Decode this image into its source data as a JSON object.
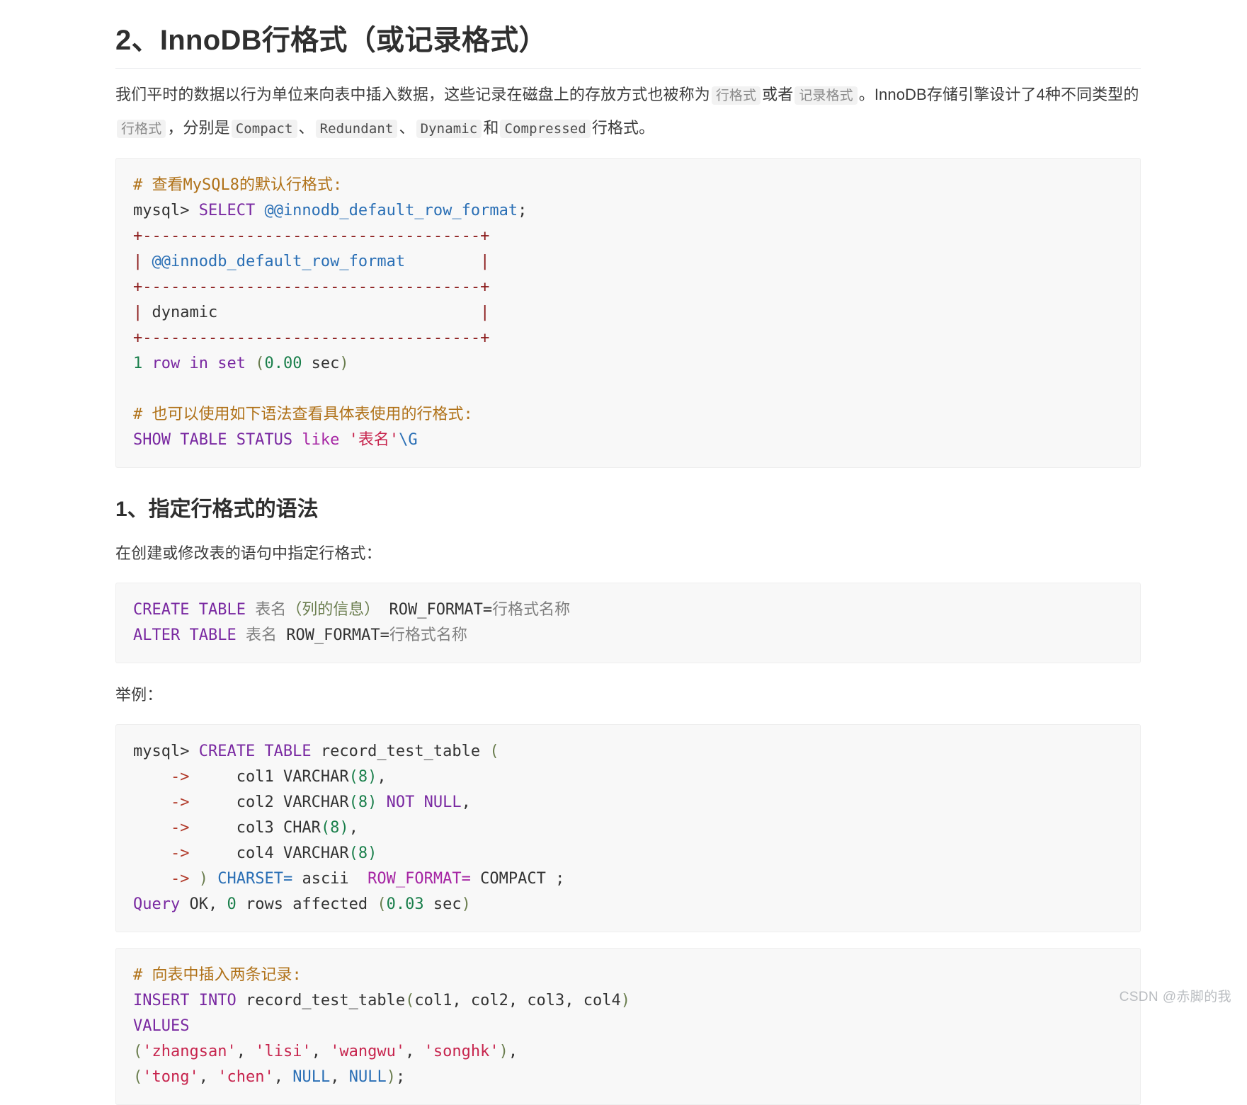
{
  "document": {
    "heading_main": "2、InnoDB行格式（或记录格式）",
    "heading_sub": "1、指定行格式的语法",
    "paragraph_intro": {
      "part1": "我们平时的数据以行为单位来向表中插入数据，这些记录在磁盘上的存放方式也被称为",
      "tag1": "行格式",
      "part2": "或者",
      "tag2": "记录格式",
      "part3": "。InnoDB存储引擎设计了4种不同类型的",
      "tag3": "行格式",
      "part4": "，分别是",
      "tag4": "Compact",
      "sep1": "、",
      "tag5": "Redundant",
      "sep2": "、",
      "tag6": "Dynamic",
      "sep3": "和",
      "tag7": "Compressed",
      "part5": "行格式。"
    },
    "paragraph_syntax": "在创建或修改表的语句中指定行格式：",
    "paragraph_example": "举例："
  },
  "code_block_1": {
    "comment_1": "# 查看MySQL8的默认行格式:",
    "prompt_1": "mysql> ",
    "kw_select": "SELECT",
    "var_1": " @@innodb_default_row_format",
    "semicolon": ";",
    "rule_1": "+------------------------------------+",
    "row_header": "| @@innodb_default_row_format        |",
    "row_header_pipe": "|",
    "row_header_var": " @@innodb_default_row_format        ",
    "row_header_pipe2": "|",
    "rule_2": "+------------------------------------+",
    "row_value_pipe": "|",
    "row_value": " dynamic                            ",
    "row_value_pipe2": "|",
    "rule_3": "+------------------------------------+",
    "result_num": "1",
    "result_text": " row in set ",
    "result_paren_open": "(",
    "result_time": "0.00",
    "result_sec": " sec",
    "result_paren_close": ")",
    "comment_2": "# 也可以使用如下语法查看具体表使用的行格式:",
    "kw_show": "SHOW TABLE STATUS",
    "kw_like": " like ",
    "str_tablename": "'表名'",
    "tok_g": "\\G"
  },
  "code_block_2": {
    "line1_kw": "CREATE TABLE",
    "line1_name": " 表名",
    "line1_paren": "（列的信息）",
    "line1_rowformat": " ROW_FORMAT=",
    "line1_value": "行格式名称",
    "line2_kw": "ALTER TABLE",
    "line2_name": " 表名",
    "line2_rowformat": " ROW_FORMAT=",
    "line2_value": "行格式名称"
  },
  "code_block_3": {
    "prompt": "mysql> ",
    "kw_create": "CREATE TABLE",
    "table_name": " record_test_table ",
    "paren_open": "(",
    "arrow": "->",
    "col1": "col1 VARCHAR",
    "col1_size": "(8)",
    "col1_comma": ",",
    "col2": "col2 VARCHAR",
    "col2_size": "(8)",
    "col2_notnull": " NOT NULL",
    "col2_comma": ",",
    "col3": "col3 CHAR",
    "col3_size": "(8)",
    "col3_comma": ",",
    "col4": "col4 VARCHAR",
    "col4_size": "(8)",
    "close_paren": ")",
    "charset_kw": " CHARSET=",
    "charset_val": " ascii  ",
    "rowformat_kw": "ROW_FORMAT=",
    "rowformat_val": " COMPACT ;",
    "query_kw": "Query",
    "query_ok": " OK, ",
    "query_num": "0",
    "query_rows": " rows affected ",
    "query_paren_open": "(",
    "query_time": "0.03",
    "query_sec": " sec",
    "query_paren_close": ")"
  },
  "code_block_4": {
    "comment": "# 向表中插入两条记录:",
    "insert_kw": "INSERT INTO",
    "insert_table": " record_test_table",
    "insert_cols_open": "(",
    "insert_cols": "col1, col2, col3, col4",
    "insert_cols_close": ")",
    "values_kw": "VALUES",
    "row1_open": "(",
    "row1_v1": "'zhangsan'",
    "row1_s1": ", ",
    "row1_v2": "'lisi'",
    "row1_s2": ", ",
    "row1_v3": "'wangwu'",
    "row1_s3": ", ",
    "row1_v4": "'songhk'",
    "row1_close": ")",
    "row1_comma": ",",
    "row2_open": "(",
    "row2_v1": "'tong'",
    "row2_s1": ", ",
    "row2_v2": "'chen'",
    "row2_s2": ", ",
    "row2_v3": "NULL",
    "row2_s3": ", ",
    "row2_v4": "NULL",
    "row2_close": ")",
    "row2_semi": ";"
  },
  "watermark": {
    "text": "CSDN @赤脚的我"
  },
  "colors": {
    "comment": "#b07219",
    "keyword": "#7928a1",
    "string": "#c7254e",
    "number": "#1a7f4b",
    "variable": "#2a6fb5",
    "rule": "#8b1a1a",
    "codebg": "#f8f8f8",
    "text": "#3c3c3c"
  }
}
